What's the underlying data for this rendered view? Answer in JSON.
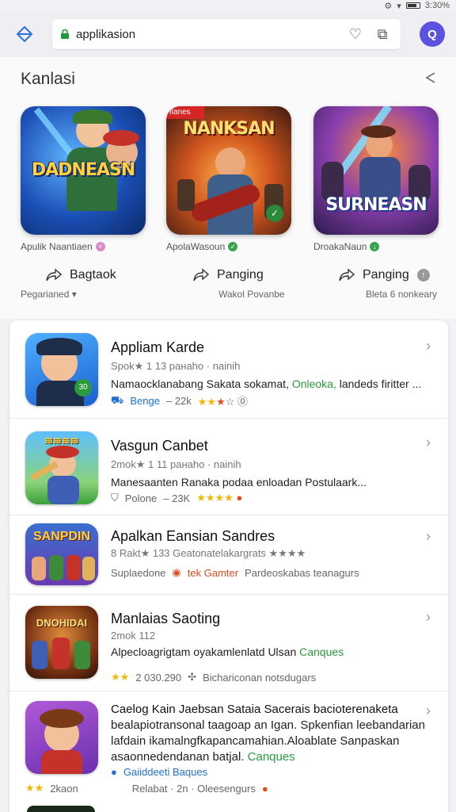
{
  "status": {
    "time": "3:30%"
  },
  "browser": {
    "url": "applikasion"
  },
  "section": {
    "title": "Kanlasi"
  },
  "featured": [
    {
      "art_title": "DADNEASN",
      "name": "Apulik Naantiaen"
    },
    {
      "art_title": "NANKSAN",
      "art_badge": "Ilanes",
      "name": "ApolaWasoun"
    },
    {
      "art_title": "SURNEASN",
      "name": "DroakaNaun"
    }
  ],
  "actions": [
    {
      "label": "Bagtaok",
      "sub": "Pegarianed"
    },
    {
      "label": "Panging",
      "sub": "Wakol Povanbe"
    },
    {
      "label": "Panging",
      "sub": "Bleta 6 nonkeary"
    }
  ],
  "apps": [
    {
      "title": "Appliam Karde",
      "sub": "Spok★ 1 13 ранаhо · nainih",
      "desc_a": "Namaocklanabang Sakata sokamat, ",
      "desc_b": "Onleoka,",
      "desc_c": " landeds firitter ...",
      "meta_a": "Benge",
      "meta_b": "– 22k",
      "badge": "30"
    },
    {
      "title": "Vasgun Canbet",
      "sub": "2mok★ 1 11 ранаhо · nainih",
      "desc_a": "Manesaanten Ranaka podaa enloadan Postulaark...",
      "meta_a": "Polone",
      "meta_b": "– 23K"
    },
    {
      "title": "Apalkan Eansian Sandres",
      "sub": "8 Rakt★ 133 Geatonatelakargrats ★★★★",
      "desc_a": "Suplaedone",
      "meta_a": "tek Gamter",
      "meta_b": "Pardeoskabas teanagurs",
      "art": "SANPDIN"
    },
    {
      "title": "Manlaias Saoting",
      "sub": "2mok 112",
      "desc_a": "Alpecloagrigtam oyakamlenlatd Ulsan ",
      "desc_b": "Canques",
      "meta_a": "2 030.290",
      "meta_b": "Bichariconan notsdugars",
      "art": "DNOHIDAI"
    },
    {
      "title": "Caelog Kain Jaebsan Sataia Sacerais bacioterenaketa",
      "line2": "bealapiotransonal taagoap an Igan. Spkenfian leebandarian",
      "line3": "lafdain ikamalngfkapancamahian.Aloablate Sanpaskan",
      "desc_a": "asaonnedendanan batjal. ",
      "desc_b": "Canques",
      "meta_pre": "Gaiiddeeti Baques",
      "meta_a": "2kaon",
      "meta_b": "Relabat · 2n · Oleesengurs"
    }
  ]
}
